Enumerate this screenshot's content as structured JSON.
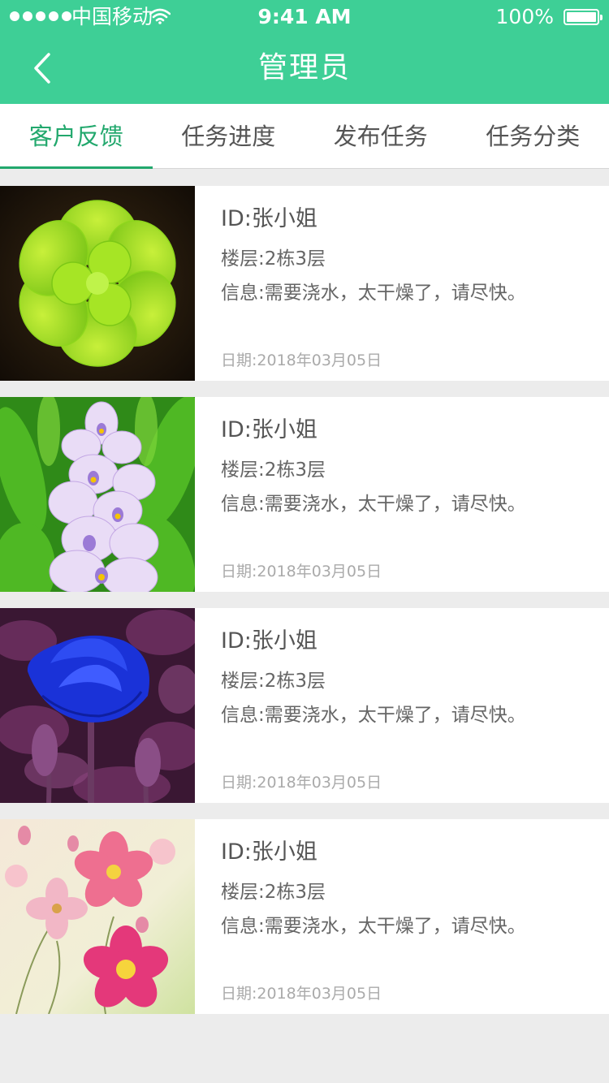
{
  "status_bar": {
    "carrier": "中国移动",
    "time": "9:41 AM",
    "battery": "100%"
  },
  "nav": {
    "title": "管理员",
    "back_icon": "chevron-left-icon"
  },
  "tabs": [
    {
      "label": "客户反馈",
      "active": true
    },
    {
      "label": "任务进度",
      "active": false
    },
    {
      "label": "发布任务",
      "active": false
    },
    {
      "label": "任务分类",
      "active": false
    }
  ],
  "colors": {
    "accent": "#3ecf96",
    "tab_active": "#22a86d",
    "background": "#ececec"
  },
  "feedback_list": [
    {
      "image": "green-succulent-photo",
      "id": "ID:张小姐",
      "floor": "楼层:2栋3层",
      "message": "信息:需要浇水，太干燥了，请尽快。",
      "date": "日期:2018年03月05日"
    },
    {
      "image": "water-hyacinth-photo",
      "id": "ID:张小姐",
      "floor": "楼层:2栋3层",
      "message": "信息:需要浇水，太干燥了，请尽快。",
      "date": "日期:2018年03月05日"
    },
    {
      "image": "blue-rose-photo",
      "id": "ID:张小姐",
      "floor": "楼层:2栋3层",
      "message": "信息:需要浇水，太干燥了，请尽快。",
      "date": "日期:2018年03月05日"
    },
    {
      "image": "pink-anemone-photo",
      "id": "ID:张小姐",
      "floor": "楼层:2栋3层",
      "message": "信息:需要浇水，太干燥了，请尽快。",
      "date": "日期:2018年03月05日"
    }
  ]
}
